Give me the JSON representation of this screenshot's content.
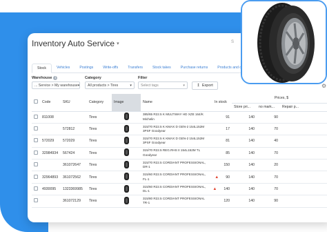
{
  "app": {
    "title": "Inventory Auto Service",
    "search_hint": "S"
  },
  "tabs": [
    {
      "label": "Stock",
      "active": true
    },
    {
      "label": "Vehicles"
    },
    {
      "label": "Postings"
    },
    {
      "label": "Write-offs"
    },
    {
      "label": "Transfers"
    },
    {
      "label": "Stock takes"
    },
    {
      "label": "Purchase returns"
    },
    {
      "label": "Products and categories"
    }
  ],
  "filters": {
    "warehouse_label": "Warehouse",
    "warehouse_value": "... Service > My warehouse",
    "category_label": "Category",
    "category_value": "All products > Tires",
    "filter_label": "Filter",
    "filter_value": "Select tags",
    "export_label": "Export"
  },
  "table": {
    "headers": {
      "code": "Code",
      "sku": "SKU",
      "category": "Category",
      "image": "Image",
      "name": "Name",
      "in_stock": "In stock",
      "prices": "Prices, $",
      "store_price": "Store pri...",
      "no_markup": "no mark...",
      "repair": "Repair p..."
    },
    "rows": [
      {
        "code": "811008",
        "sku": "",
        "category": "Tires",
        "name": "385/65 R22.5 K MULTIWAY HD XZE 164/K Michelin",
        "stock": "91",
        "warn": false,
        "store": "140",
        "nomark": "90",
        "repair": ""
      },
      {
        "code": "",
        "sku": "572812",
        "category": "Tires",
        "name": "315/70 R22.5 K KMAX D GEN-2 154L152M 3PSF Goodyear",
        "stock": "17",
        "warn": false,
        "store": "140",
        "nomark": "70",
        "repair": ""
      },
      {
        "code": "572029",
        "sku": "572029",
        "category": "Tires",
        "name": "315/70 R22.5 K KMAX D GEN-2 154L152M 3PSF Goodyear",
        "stock": "81",
        "warn": false,
        "store": "140",
        "nomark": "40",
        "repair": ""
      },
      {
        "code": "32984934",
        "sku": "567424",
        "category": "Tires",
        "name": "315/70 R22.5 REG.RHS II 154L152M TL Goodyear",
        "stock": "85",
        "warn": false,
        "store": "140",
        "nomark": "70",
        "repair": ""
      },
      {
        "code": "",
        "sku": "361072647",
        "category": "Tires",
        "name": "315/70 R22.5 CORDIANT PROFESSIONAL, DR-1",
        "stock": "150",
        "warn": false,
        "store": "140",
        "nomark": "20",
        "repair": ""
      },
      {
        "code": "32964893",
        "sku": "361072562",
        "category": "Tires",
        "name": "315/60 R22.5 CORDIANT PROFESSIONAL, FL-1",
        "stock": "90",
        "warn": true,
        "store": "140",
        "nomark": "70",
        "repair": ""
      },
      {
        "code": "4930095",
        "sku": "1323369985",
        "category": "Tires",
        "name": "315/60 R22.5 CORDIANT PROFESSIONAL, DL-1",
        "stock": "140",
        "warn": true,
        "store": "140",
        "nomark": "70",
        "repair": ""
      },
      {
        "code": "",
        "sku": "361072129",
        "category": "Tires",
        "name": "315/80 R22.5 CORDIANT PROFESSIONAL TR-1",
        "stock": "120",
        "warn": false,
        "store": "140",
        "nomark": "90",
        "repair": ""
      }
    ]
  },
  "colors": {
    "accent": "#2f8fea",
    "link": "#3b7fd4",
    "warning": "#e2432f"
  },
  "icons": [
    "chevron-down-icon",
    "info-icon",
    "export-icon",
    "tire-image",
    "warning-icon",
    "gear-icon"
  ]
}
